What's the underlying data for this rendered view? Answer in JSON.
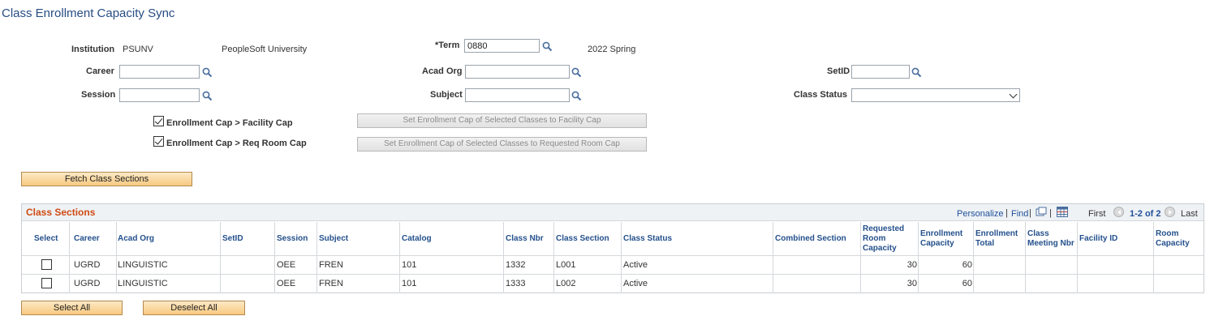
{
  "page": {
    "title": "Class Enrollment Capacity Sync"
  },
  "form": {
    "institution_label": "Institution",
    "institution_value": "PSUNV",
    "institution_desc": "PeopleSoft University",
    "term_label": "*Term",
    "term_value": "0880",
    "term_desc": "2022 Spring",
    "career_label": "Career",
    "career_value": "",
    "acad_org_label": "Acad Org",
    "acad_org_value": "",
    "setid_label": "SetID",
    "setid_value": "",
    "session_label": "Session",
    "session_value": "",
    "subject_label": "Subject",
    "subject_value": "",
    "class_status_label": "Class Status",
    "class_status_value": "",
    "enroll_facility_label": "Enrollment Cap > Facility Cap",
    "enroll_facility_checked": true,
    "enroll_room_label": "Enrollment Cap > Req Room Cap",
    "enroll_room_checked": true,
    "set_facility_btn": "Set Enrollment Cap of Selected Classes to Facility Cap",
    "set_room_btn": "Set Enrollment Cap of Selected Classes to Requested Room Cap",
    "fetch_btn": "Fetch Class Sections"
  },
  "grid": {
    "title": "Class Sections",
    "personalize": "Personalize",
    "find": "Find",
    "sep": "|",
    "first": "First",
    "range": "1-2 of 2",
    "last": "Last",
    "headers": {
      "select": "Select",
      "career": "Career",
      "acad_org": "Acad Org",
      "setid": "SetID",
      "session": "Session",
      "subject": "Subject",
      "catalog": "Catalog",
      "class_nbr": "Class Nbr",
      "class_section": "Class Section",
      "class_status": "Class Status",
      "combined_section": "Combined Section",
      "req_room_cap_1": "Requested",
      "req_room_cap_2": "Room",
      "req_room_cap_3": "Capacity",
      "enroll_cap_1": "Enrollment",
      "enroll_cap_2": "Capacity",
      "enroll_total_1": "Enrollment",
      "enroll_total_2": "Total",
      "meeting_nbr_1": "Class",
      "meeting_nbr_2": "Meeting Nbr",
      "facility_id": "Facility ID",
      "room_cap_1": "Room",
      "room_cap_2": "Capacity"
    },
    "rows": [
      {
        "career": "UGRD",
        "acad_org": "LINGUISTIC",
        "setid": "",
        "session": "OEE",
        "subject": "FREN",
        "catalog": "101",
        "class_nbr": "1332",
        "class_section": "L001",
        "class_status": "Active",
        "combined_section": "",
        "req_room_cap": "30",
        "enroll_cap": "60",
        "enroll_total": "",
        "meeting_nbr": "",
        "facility_id": "",
        "room_cap": ""
      },
      {
        "career": "UGRD",
        "acad_org": "LINGUISTIC",
        "setid": "",
        "session": "OEE",
        "subject": "FREN",
        "catalog": "101",
        "class_nbr": "1333",
        "class_section": "L002",
        "class_status": "Active",
        "combined_section": "",
        "req_room_cap": "30",
        "enroll_cap": "60",
        "enroll_total": "",
        "meeting_nbr": "",
        "facility_id": "",
        "room_cap": ""
      }
    ]
  },
  "footer": {
    "select_all": "Select All",
    "deselect_all": "Deselect All"
  },
  "colors": {
    "title": "#284d84",
    "grid_title": "#d04a13",
    "link": "#1f4f99",
    "button": "#f7c980"
  }
}
